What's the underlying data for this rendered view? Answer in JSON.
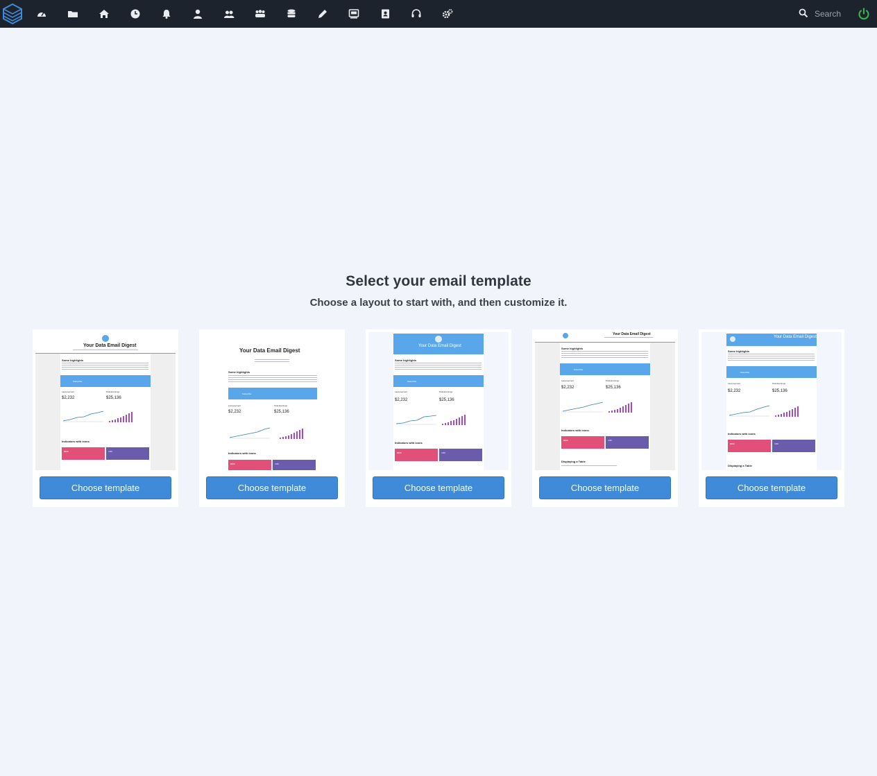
{
  "nav": {
    "icons": [
      "dashboard-icon",
      "folder-icon",
      "home-icon",
      "clock-icon",
      "bell-icon",
      "user-icon",
      "users-icon",
      "group-icon",
      "database-icon",
      "pencil-icon",
      "monitor-icon",
      "contact-book-icon",
      "headset-icon",
      "cogs-icon"
    ]
  },
  "search": {
    "placeholder": "Search"
  },
  "colors": {
    "topbar": "#1d232c",
    "background": "#f1f4fb",
    "accent": "#3f8bd9",
    "power": "#38b24a",
    "mini_blue": "#5aa6ea",
    "mini_pink": "#e24f79",
    "mini_purple": "#6a5bab",
    "mini_bars": "#a24bbf"
  },
  "page": {
    "title": "Select your email template",
    "subtitle": "Choose a layout to start with, and then customize it."
  },
  "templates": [
    {
      "button_label": "Choose template",
      "preview": {
        "title": "Your Data Email Digest",
        "heading": "Some highlights",
        "banner": "Subscribe",
        "stat1_label": "Last payment",
        "stat1_value": "$2,232",
        "stat2_label": "Total Earnings",
        "stat2_value": "$25,136",
        "section2": "Indicators with icons",
        "tile1_value": "$50K",
        "tile2_value": "4.8K"
      }
    },
    {
      "button_label": "Choose template",
      "preview": {
        "title": "Your Data Email Digest",
        "heading": "Some highlights",
        "banner": "Subscribe",
        "stat1_label": "Last payment",
        "stat1_value": "$2,232",
        "stat2_label": "Total Earnings",
        "stat2_value": "$25,136",
        "section2": "Indicators with icons",
        "tile1_value": "$50K",
        "tile2_value": "4.8K"
      }
    },
    {
      "button_label": "Choose template",
      "preview": {
        "title": "Your Data Email Digest",
        "heading": "Some highlights",
        "banner": "Subscribe",
        "stat1_label": "Last payment",
        "stat1_value": "$2,232",
        "stat2_label": "Total Earnings",
        "stat2_value": "$25,136",
        "section2": "Indicators with icons",
        "tile1_value": "$50K",
        "tile2_value": "4.8K"
      }
    },
    {
      "button_label": "Choose template",
      "preview": {
        "title": "Your Data Email Digest",
        "heading": "Some highlights",
        "banner": "Subscribe",
        "stat1_label": "Last payment",
        "stat1_value": "$2,232",
        "stat2_label": "Total Earnings",
        "stat2_value": "$25,136",
        "section2": "Indicators with icons",
        "tile1_value": "$50K",
        "tile2_value": "4.8K",
        "section3": "Displaying a Table"
      }
    },
    {
      "button_label": "Choose template",
      "preview": {
        "title": "Your Data Email Digest",
        "heading": "Some highlights",
        "banner": "Subscribe",
        "stat1_label": "Last payment",
        "stat1_value": "$2,232",
        "stat2_label": "Total Earnings",
        "stat2_value": "$25,136",
        "section2": "Indicators with icons",
        "tile1_value": "$50K",
        "tile2_value": "4.8K",
        "section3": "Displaying a Table"
      }
    }
  ]
}
